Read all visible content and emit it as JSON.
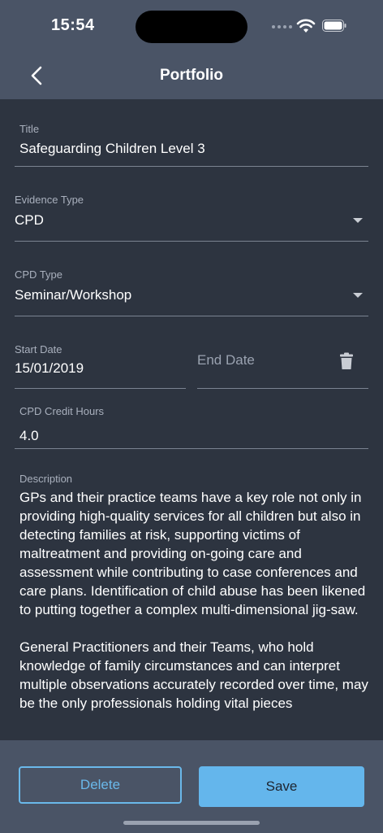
{
  "status": {
    "time": "15:54"
  },
  "nav": {
    "title": "Portfolio"
  },
  "form": {
    "title": {
      "label": "Title",
      "value": "Safeguarding Children Level 3"
    },
    "evidence_type": {
      "label": "Evidence Type",
      "value": "CPD"
    },
    "cpd_type": {
      "label": "CPD Type",
      "value": "Seminar/Workshop"
    },
    "start_date": {
      "label": "Start Date",
      "value": "15/01/2019"
    },
    "end_date": {
      "placeholder": "End Date"
    },
    "credit_hours": {
      "label": "CPD Credit Hours",
      "value": "4.0"
    },
    "description": {
      "label": "Description",
      "value": "GPs and their practice teams have a key role not only in providing high-quality services for all children but also in detecting families at risk, supporting victims of maltreatment and providing on-going care and assessment while contributing to case conferences and care plans. Identification of child abuse has been likened to putting together a complex multi-dimensional jig-saw.\n\nGeneral Practitioners and their Teams, who hold knowledge of family circumstances and can interpret multiple observations accurately recorded over time, may be the only professionals holding vital pieces"
    }
  },
  "actions": {
    "delete_label": "Delete",
    "save_label": "Save"
  },
  "icons": {
    "back": "chevron-left-icon",
    "trash": "trash-icon",
    "dropdown": "caret-down-icon"
  },
  "colors": {
    "accent": "#64b6ec",
    "background": "#2d3440",
    "header": "#4a5466"
  }
}
